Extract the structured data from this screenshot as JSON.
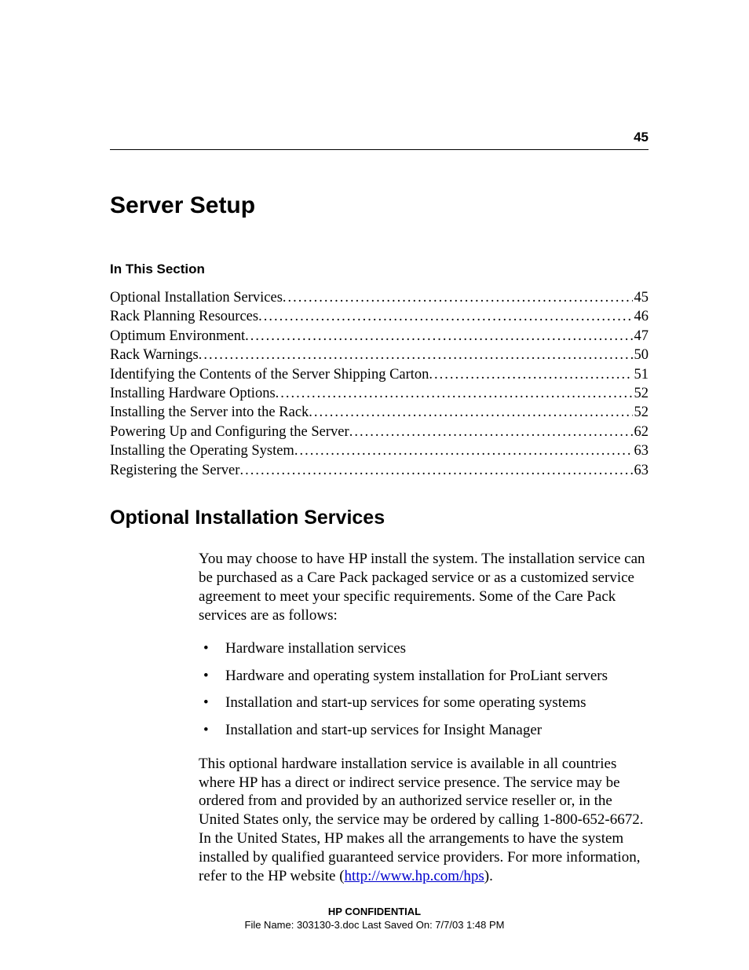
{
  "page_number": "45",
  "title": "Server Setup",
  "in_this_section_label": "In This Section",
  "toc": [
    {
      "label": "Optional Installation Services",
      "page": "45"
    },
    {
      "label": "Rack Planning Resources ",
      "page": "46"
    },
    {
      "label": "Optimum Environment",
      "page": "47"
    },
    {
      "label": "Rack Warnings ",
      "page": "50"
    },
    {
      "label": "Identifying the Contents of the Server Shipping Carton",
      "page": "51"
    },
    {
      "label": "Installing Hardware Options",
      "page": "52"
    },
    {
      "label": "Installing the Server into the Rack ",
      "page": "52"
    },
    {
      "label": "Powering Up and Configuring the Server ",
      "page": "62"
    },
    {
      "label": "Installing the Operating System ",
      "page": "63"
    },
    {
      "label": "Registering the Server ",
      "page": "63"
    }
  ],
  "section_heading": "Optional Installation Services",
  "para1": "You may choose to have HP install the system. The installation service can be purchased as a Care Pack packaged service or as a customized service agreement to meet your specific requirements. Some of the Care Pack services are as follows:",
  "bullets": [
    "Hardware installation services",
    "Hardware and operating system installation for ProLiant servers",
    "Installation and start-up services for some operating systems",
    "Installation and start-up services for Insight Manager"
  ],
  "para2_pre": "This optional hardware installation service is available in all countries where HP has a direct or indirect service presence. The service may be ordered from and provided by an authorized service reseller or, in the United States only, the service may be ordered by calling 1-800-652-6672. In the United States, HP makes all the arrangements to have the system installed by qualified guaranteed service providers. For more information, refer to the HP website (",
  "link_text": "http://www.hp.com/hps",
  "para2_post": ").",
  "footer_bold": "HP CONFIDENTIAL",
  "footer_line2": "File Name: 303130-3.doc   Last Saved On: 7/7/03 1:48 PM"
}
